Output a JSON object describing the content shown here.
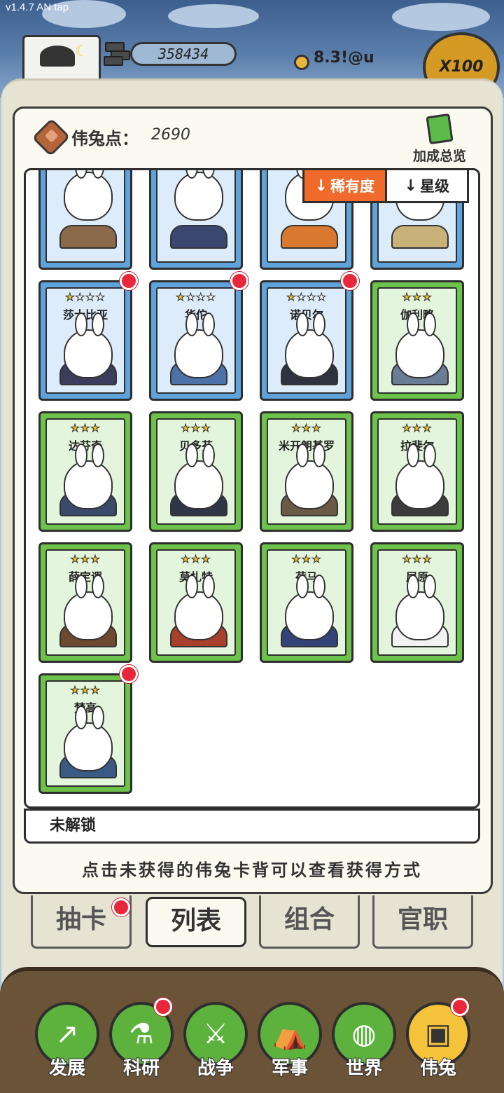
{
  "status": {
    "version": "v1.4.7 AN tap"
  },
  "header": {
    "resource_value": "358434",
    "income": "8.3!@u",
    "multiplier": "X100"
  },
  "panel": {
    "points_label": "伟兔点：",
    "points_value": "2690",
    "bonus_overview": "加成总览"
  },
  "sort": {
    "rarity": "稀有度",
    "star_level": "星级",
    "rarity_arrow": "↓",
    "star_arrow": "↓"
  },
  "cards": [
    {
      "name": "",
      "stars": 0,
      "max_stars": 0,
      "tier": "blue",
      "partial": true,
      "coat": "#8a6a4a",
      "badge": false
    },
    {
      "name": "",
      "stars": 0,
      "max_stars": 0,
      "tier": "blue",
      "partial": true,
      "coat": "#3a4870",
      "badge": false
    },
    {
      "name": "",
      "stars": 0,
      "max_stars": 0,
      "tier": "blue",
      "partial": true,
      "coat": "#d9792f",
      "badge": false
    },
    {
      "name": "",
      "stars": 0,
      "max_stars": 0,
      "tier": "blue",
      "partial": true,
      "coat": "#c9b27a",
      "badge": false
    },
    {
      "name": "莎士比亚",
      "stars": 1,
      "max_stars": 4,
      "tier": "blue",
      "partial": false,
      "coat": "#3c3c5c",
      "badge": true
    },
    {
      "name": "华佗",
      "stars": 1,
      "max_stars": 4,
      "tier": "blue",
      "partial": false,
      "coat": "#4d72a8",
      "badge": true
    },
    {
      "name": "诺贝尔",
      "stars": 1,
      "max_stars": 4,
      "tier": "blue",
      "partial": false,
      "coat": "#2f3340",
      "badge": true
    },
    {
      "name": "伽利略",
      "stars": 3,
      "max_stars": 3,
      "tier": "green",
      "partial": false,
      "coat": "#6a7c96",
      "badge": false
    },
    {
      "name": "达芬奇",
      "stars": 3,
      "max_stars": 3,
      "tier": "green",
      "partial": false,
      "coat": "#3a4a6a",
      "badge": false
    },
    {
      "name": "贝多芬",
      "stars": 3,
      "max_stars": 3,
      "tier": "green",
      "partial": false,
      "coat": "#2f3647",
      "badge": false
    },
    {
      "name": "米开朗基罗",
      "stars": 3,
      "max_stars": 3,
      "tier": "green",
      "partial": false,
      "coat": "#6b5a48",
      "badge": false
    },
    {
      "name": "拉斐尔",
      "stars": 3,
      "max_stars": 3,
      "tier": "green",
      "partial": false,
      "coat": "#3c3c3c",
      "badge": false
    },
    {
      "name": "薛定谔",
      "stars": 3,
      "max_stars": 3,
      "tier": "green",
      "partial": false,
      "coat": "#6d4a2f",
      "badge": false
    },
    {
      "name": "莫扎特",
      "stars": 3,
      "max_stars": 3,
      "tier": "green",
      "partial": false,
      "coat": "#a8402c",
      "badge": false
    },
    {
      "name": "荷马",
      "stars": 3,
      "max_stars": 3,
      "tier": "green",
      "partial": false,
      "coat": "#34427a",
      "badge": false
    },
    {
      "name": "屈原",
      "stars": 3,
      "max_stars": 3,
      "tier": "green",
      "partial": false,
      "coat": "#f2f2f2",
      "badge": false
    },
    {
      "name": "梵高",
      "stars": 3,
      "max_stars": 3,
      "tier": "green",
      "partial": false,
      "coat": "#3a5a86",
      "badge": true
    }
  ],
  "locked_label": "未解锁",
  "hint": "点击未获得的伟兔卡背可以查看获得方式",
  "tabs": [
    {
      "label": "抽卡",
      "badge": true,
      "active": false
    },
    {
      "label": "列表",
      "badge": false,
      "active": true
    },
    {
      "label": "组合",
      "badge": false,
      "active": false
    },
    {
      "label": "官职",
      "badge": false,
      "active": false
    }
  ],
  "nav": [
    {
      "label": "发展",
      "icon": "graph-arrow-icon",
      "glyph": "↗",
      "badge": false,
      "active": false
    },
    {
      "label": "科研",
      "icon": "flask-icon",
      "glyph": "⚗",
      "badge": true,
      "active": false
    },
    {
      "label": "战争",
      "icon": "crossed-swords-icon",
      "glyph": "⚔",
      "badge": false,
      "active": false
    },
    {
      "label": "军事",
      "icon": "tent-icon",
      "glyph": "⛺",
      "badge": false,
      "active": false
    },
    {
      "label": "世界",
      "icon": "globe-icon",
      "glyph": "◍",
      "badge": false,
      "active": false
    },
    {
      "label": "伟兔",
      "icon": "rabbit-portrait-icon",
      "glyph": "▣",
      "badge": true,
      "active": true
    }
  ],
  "colors": {
    "sort_active": "#f06a2c",
    "badge": "#e8283a",
    "card_blue": "#5fa3dc",
    "card_green": "#6cc24a"
  }
}
